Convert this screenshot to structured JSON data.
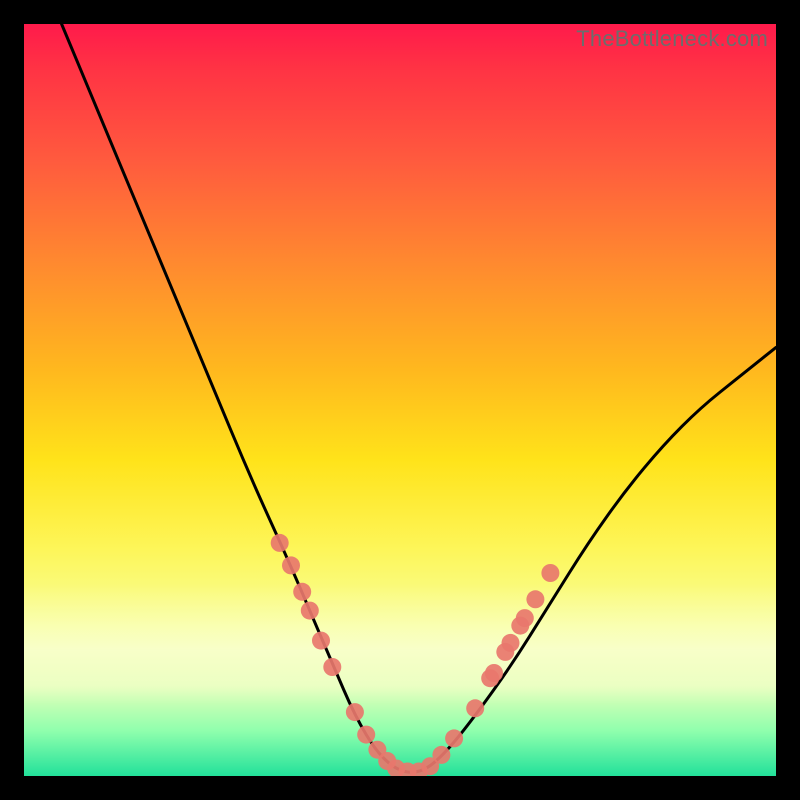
{
  "watermark": "TheBottleneck.com",
  "chart_data": {
    "type": "line",
    "title": "",
    "xlabel": "",
    "ylabel": "",
    "xlim": [
      0,
      100
    ],
    "ylim": [
      0,
      100
    ],
    "grid": false,
    "legend": false,
    "curve": {
      "name": "bottleneck-curve",
      "color": "#000000",
      "x": [
        5,
        10,
        15,
        20,
        25,
        30,
        35,
        38,
        41,
        44,
        47,
        50,
        53,
        56,
        60,
        65,
        70,
        75,
        80,
        85,
        90,
        95,
        100
      ],
      "y": [
        100,
        88,
        76,
        64,
        52,
        40,
        29,
        22,
        15,
        8,
        3,
        0.5,
        0.5,
        3,
        8,
        15,
        23,
        31,
        38,
        44,
        49,
        53,
        57
      ]
    },
    "markers": {
      "name": "scatter-points",
      "color": "#e8776c",
      "radius": 9,
      "points": [
        {
          "x": 34,
          "y": 31
        },
        {
          "x": 35.5,
          "y": 28
        },
        {
          "x": 37,
          "y": 24.5
        },
        {
          "x": 38,
          "y": 22
        },
        {
          "x": 39.5,
          "y": 18
        },
        {
          "x": 41,
          "y": 14.5
        },
        {
          "x": 44,
          "y": 8.5
        },
        {
          "x": 45.5,
          "y": 5.5
        },
        {
          "x": 47,
          "y": 3.5
        },
        {
          "x": 48.3,
          "y": 2
        },
        {
          "x": 49.5,
          "y": 1
        },
        {
          "x": 51,
          "y": 0.6
        },
        {
          "x": 52.5,
          "y": 0.6
        },
        {
          "x": 54,
          "y": 1.3
        },
        {
          "x": 55.5,
          "y": 2.8
        },
        {
          "x": 57.2,
          "y": 5
        },
        {
          "x": 60,
          "y": 9
        },
        {
          "x": 62,
          "y": 13
        },
        {
          "x": 62.5,
          "y": 13.7
        },
        {
          "x": 64,
          "y": 16.5
        },
        {
          "x": 64.7,
          "y": 17.7
        },
        {
          "x": 66,
          "y": 20
        },
        {
          "x": 66.6,
          "y": 21
        },
        {
          "x": 68,
          "y": 23.5
        },
        {
          "x": 70,
          "y": 27
        }
      ]
    },
    "gradient_stops": [
      {
        "pos": 0,
        "color": "#ff1a4b"
      },
      {
        "pos": 18,
        "color": "#ff5a3e"
      },
      {
        "pos": 46,
        "color": "#ffb81e"
      },
      {
        "pos": 70,
        "color": "#fdf65a"
      },
      {
        "pos": 94,
        "color": "#8fffad"
      },
      {
        "pos": 100,
        "color": "#22e19a"
      }
    ]
  }
}
